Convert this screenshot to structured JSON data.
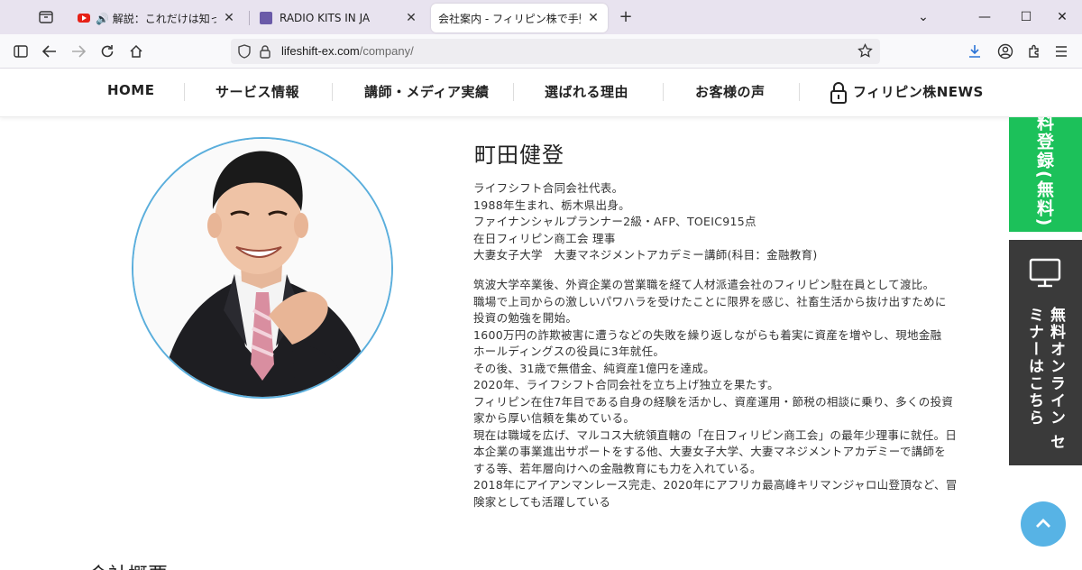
{
  "browser": {
    "tabs": [
      {
        "title": "🔊 解説：これだけは知っておきた",
        "active": false
      },
      {
        "title": "RADIO KITS IN JA",
        "active": false
      },
      {
        "title": "会社案内 - フィリピン株で手堅く資産を",
        "active": true
      }
    ],
    "url": {
      "host": "lifeshift-ex.com",
      "path": "/company/"
    }
  },
  "site_nav": {
    "items": [
      "HOME",
      "サービス情報",
      "講師・メディア実績",
      "選ばれる理由",
      "お客様の声",
      "フィリピン株NEWS"
    ]
  },
  "profile": {
    "name": "町田健登",
    "summary": [
      "ライフシフト合同会社代表。",
      "1988年生まれ、栃木県出身。",
      "ファイナンシャルプランナー2級・AFP、TOEIC915点",
      "在日フィリピン商工会 理事",
      "大妻女子大学　大妻マネジメントアカデミー講師(科目：金融教育)"
    ],
    "bio": [
      "筑波大学卒業後、外資企業の営業職を経て人材派遣会社のフィリピン駐在員として渡比。",
      "職場で上司からの激しいパワハラを受けたことに限界を感じ、社畜生活から抜け出すために",
      "投資の勉強を開始。",
      "1600万円の詐欺被害に遭うなどの失敗を繰り返しながらも着実に資産を増やし、現地金融",
      "ホールディングスの役員に3年就任。",
      "その後、31歳で無借金、純資産1億円を達成。",
      "2020年、ライフシフト合同会社を立ち上げ独立を果たす。",
      "フィリピン在住7年目である自身の経験を活かし、資産運用・節税の相談に乗り、多くの投資",
      "家から厚い信頼を集めている。",
      "現在は職域を広げ、マルコス大統領直轄の「在日フィリピン商工会」の最年少理事に就任。日",
      "本企業の事業進出サポートをする他、大妻女子大学、大妻マネジメントアカデミーで講師を",
      "する等、若年層向けへの金融教育にも力を入れている。",
      "2018年にアイアンマンレース完走、2020年にアフリカ最高峰キリマンジャロ山登頂など、冒",
      "険家としても活躍している"
    ]
  },
  "section_peek": "会社概要",
  "side_buttons": {
    "register": "料登録(無料)",
    "seminar": [
      "無料オンライン",
      "セミナーはこちら"
    ]
  },
  "colors": {
    "accent_blue": "#57b3e5",
    "register_green": "#1cc15a",
    "seminar_dark": "#3a3a3a"
  }
}
